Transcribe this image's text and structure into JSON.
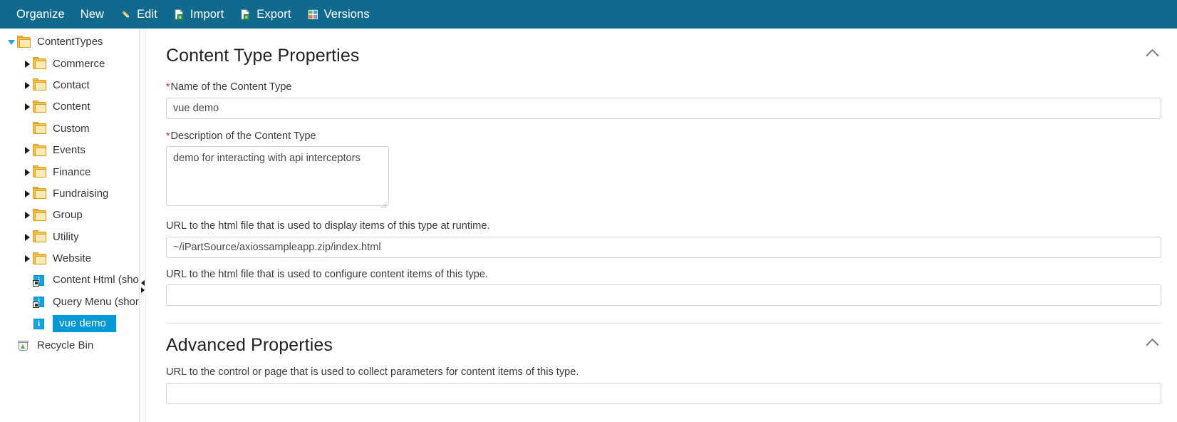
{
  "toolbar": {
    "items": [
      {
        "label": "Organize",
        "icon": "none"
      },
      {
        "label": "New",
        "icon": "none"
      },
      {
        "label": "Edit",
        "icon": "pencil-icon"
      },
      {
        "label": "Import",
        "icon": "import-document-icon"
      },
      {
        "label": "Export",
        "icon": "export-document-icon"
      },
      {
        "label": "Versions",
        "icon": "versions-grid-icon"
      }
    ],
    "background_color": "#11698e",
    "text_color": "#ffffff"
  },
  "sidebar": {
    "tree": [
      {
        "label": "ContentTypes",
        "icon": "folder-icon",
        "depth": 0,
        "twisty": "down",
        "selected": false
      },
      {
        "label": "Commerce",
        "icon": "folder-icon",
        "depth": 1,
        "twisty": "right",
        "selected": false
      },
      {
        "label": "Contact",
        "icon": "folder-icon",
        "depth": 1,
        "twisty": "right",
        "selected": false
      },
      {
        "label": "Content",
        "icon": "folder-icon",
        "depth": 1,
        "twisty": "right",
        "selected": false
      },
      {
        "label": "Custom",
        "icon": "folder-icon",
        "depth": 1,
        "twisty": "none",
        "selected": false
      },
      {
        "label": "Events",
        "icon": "folder-icon",
        "depth": 1,
        "twisty": "right",
        "selected": false
      },
      {
        "label": "Finance",
        "icon": "folder-icon",
        "depth": 1,
        "twisty": "right",
        "selected": false
      },
      {
        "label": "Fundraising",
        "icon": "folder-icon",
        "depth": 1,
        "twisty": "right",
        "selected": false
      },
      {
        "label": "Group",
        "icon": "folder-icon",
        "depth": 1,
        "twisty": "right",
        "selected": false
      },
      {
        "label": "Utility",
        "icon": "folder-icon",
        "depth": 1,
        "twisty": "right",
        "selected": false
      },
      {
        "label": "Website",
        "icon": "folder-icon",
        "depth": 1,
        "twisty": "right",
        "selected": false
      },
      {
        "label": "Content Html (shortcut)",
        "icon": "content-item-shortcut-icon",
        "depth": 1,
        "twisty": "none",
        "selected": false
      },
      {
        "label": "Query Menu (shortcut)",
        "icon": "content-item-shortcut-icon",
        "depth": 1,
        "twisty": "none",
        "selected": false
      },
      {
        "label": "vue demo",
        "icon": "content-item-icon",
        "depth": 1,
        "twisty": "none",
        "selected": true
      },
      {
        "label": "Recycle Bin",
        "icon": "recycle-bin-icon",
        "depth": 0,
        "twisty": "none",
        "selected": false
      }
    ],
    "selection_color": "#0099d8"
  },
  "main": {
    "sections": [
      {
        "title": "Content Type Properties",
        "collapse_icon": "chevron-up-icon",
        "fields": [
          {
            "label": "Name of the Content Type",
            "required": true,
            "type": "text",
            "value": "vue demo",
            "placeholder": ""
          },
          {
            "label": "Description of the Content Type",
            "required": true,
            "type": "textarea",
            "value": "demo for interacting with api interceptors",
            "placeholder": ""
          },
          {
            "label": "URL to the html file that is used to display items of this type at runtime.",
            "required": false,
            "type": "text",
            "value": "~/iPartSource/axiossampleapp.zip/index.html",
            "placeholder": ""
          },
          {
            "label": "URL to the html file that is used to configure content items of this type.",
            "required": false,
            "type": "text",
            "value": "",
            "placeholder": ""
          }
        ]
      },
      {
        "title": "Advanced Properties",
        "collapse_icon": "chevron-up-icon",
        "fields": [
          {
            "label": "URL to the control or page that is used to collect parameters for content items of this type.",
            "required": false,
            "type": "text",
            "value": "",
            "placeholder": ""
          }
        ]
      }
    ]
  }
}
